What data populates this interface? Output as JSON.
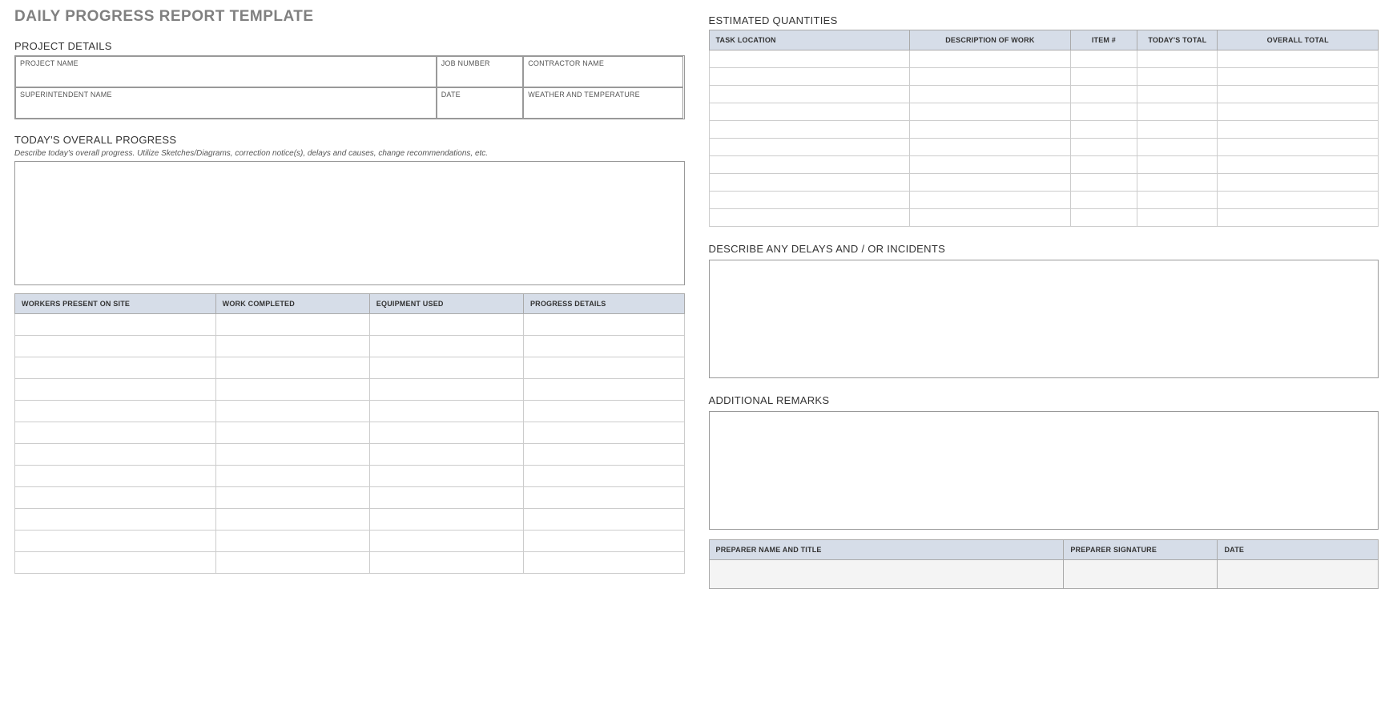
{
  "title": "DAILY PROGRESS REPORT TEMPLATE",
  "left": {
    "project_details": {
      "heading": "PROJECT DETAILS",
      "project_name": "PROJECT NAME",
      "job_number": "JOB NUMBER",
      "contractor_name": "CONTRACTOR NAME",
      "superintendent_name": "SUPERINTENDENT NAME",
      "date": "DATE",
      "weather": "WEATHER AND TEMPERATURE"
    },
    "overall_progress": {
      "heading": "TODAY'S OVERALL PROGRESS",
      "hint": "Describe today's overall progress.  Utilize Sketches/Diagrams, correction notice(s), delays and causes, change recommendations, etc."
    },
    "workers_table": {
      "headers": [
        "WORKERS PRESENT ON SITE",
        "WORK COMPLETED",
        "EQUIPMENT USED",
        "PROGRESS DETAILS"
      ],
      "rows": 12
    }
  },
  "right": {
    "quantities": {
      "heading": "ESTIMATED QUANTITIES",
      "headers": [
        "TASK LOCATION",
        "DESCRIPTION OF WORK",
        "ITEM #",
        "TODAY'S TOTAL",
        "OVERALL TOTAL"
      ],
      "rows": 10
    },
    "delays": {
      "heading": "DESCRIBE ANY DELAYS AND / OR INCIDENTS"
    },
    "remarks": {
      "heading": "ADDITIONAL REMARKS"
    },
    "sign": {
      "headers": [
        "PREPARER NAME AND TITLE",
        "PREPARER SIGNATURE",
        "DATE"
      ]
    }
  }
}
